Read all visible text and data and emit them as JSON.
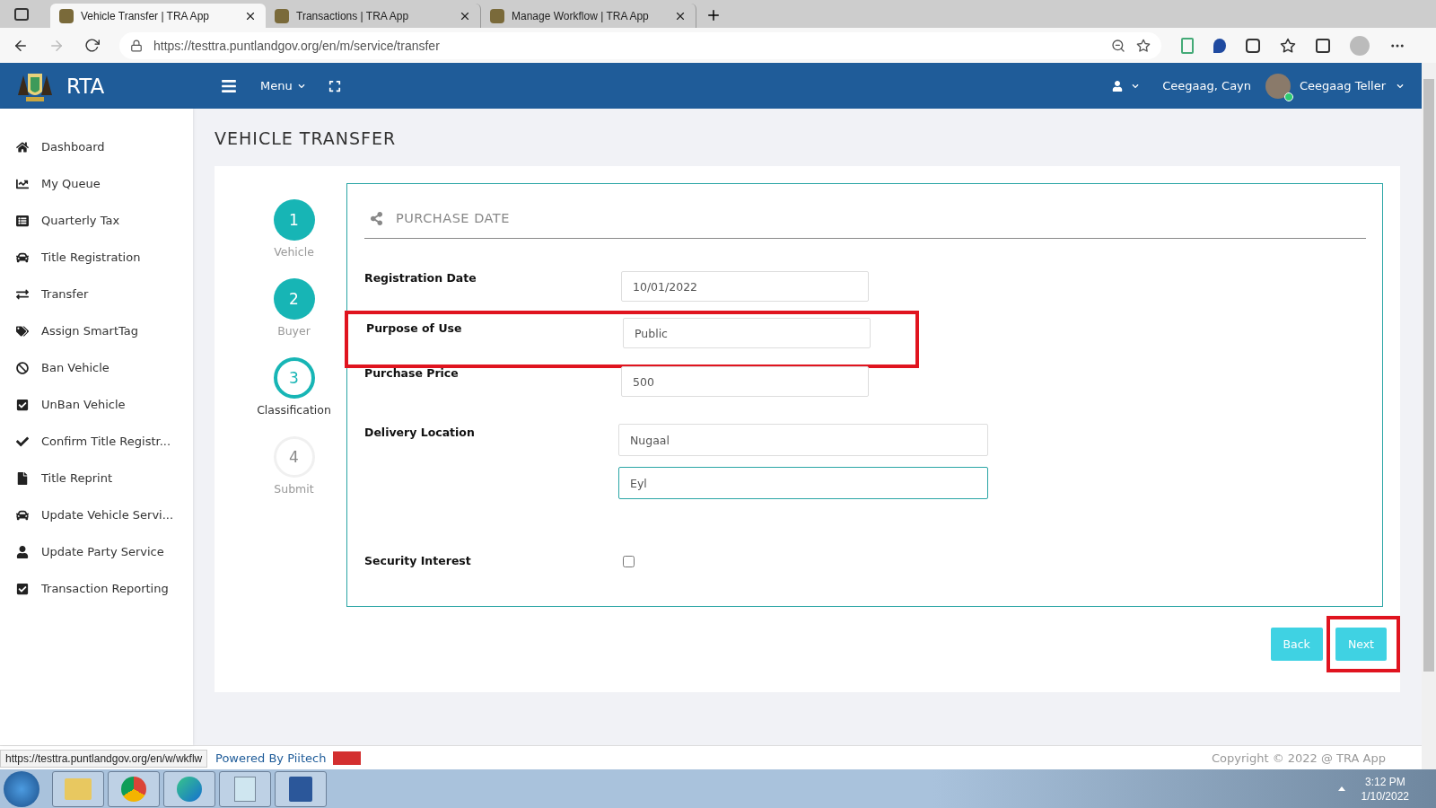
{
  "browser": {
    "tabs": [
      {
        "title": "Vehicle Transfer | TRA App",
        "selected": true
      },
      {
        "title": "Transactions | TRA App",
        "selected": false
      },
      {
        "title": "Manage Workflow | TRA App",
        "selected": false
      }
    ],
    "url": "https://testtra.puntlandgov.org/en/m/service/transfer"
  },
  "header": {
    "brand": "RTA",
    "menu": "Menu",
    "user_short": "Ceegaag, Cayn",
    "user_role": "Ceegaag Teller",
    "online": true
  },
  "sidebar": {
    "items": [
      {
        "label": "Dashboard"
      },
      {
        "label": "My Queue"
      },
      {
        "label": "Quarterly Tax"
      },
      {
        "label": "Title Registration"
      },
      {
        "label": "Transfer"
      },
      {
        "label": "Assign SmartTag"
      },
      {
        "label": "Ban Vehicle"
      },
      {
        "label": "UnBan Vehicle"
      },
      {
        "label": "Confirm Title Registr..."
      },
      {
        "label": "Title Reprint"
      },
      {
        "label": "Update Vehicle Servi..."
      },
      {
        "label": "Update Party Service"
      },
      {
        "label": "Transaction Reporting"
      }
    ]
  },
  "page_title": "VEHICLE TRANSFER",
  "steps": [
    {
      "number": "1",
      "label": "Vehicle",
      "done": true,
      "selected": false
    },
    {
      "number": "2",
      "label": "Buyer",
      "done": true,
      "selected": false
    },
    {
      "number": "3",
      "label": "Classification",
      "done": false,
      "selected": true
    },
    {
      "number": "4",
      "label": "Submit",
      "done": false,
      "selected": false
    }
  ],
  "form": {
    "section_title": "PURCHASE DATE",
    "fields": [
      {
        "label": "Registration Date",
        "kind": "text",
        "values": [
          "10/01/2022"
        ],
        "highlighted": false
      },
      {
        "label": "Purpose of Use",
        "kind": "text",
        "values": [
          "Public"
        ],
        "highlighted": true
      },
      {
        "label": "Purchase Price",
        "kind": "text",
        "values": [
          "500"
        ],
        "highlighted": false
      },
      {
        "label": "Delivery Location",
        "kind": "wide",
        "values": [
          "Nugaal",
          "Eyl"
        ],
        "highlighted": false
      },
      {
        "label": "Security Interest",
        "kind": "checkbox",
        "checked": false,
        "highlighted": false
      }
    ]
  },
  "buttons": [
    {
      "label": "Back",
      "highlighted": false
    },
    {
      "label": "Next",
      "highlighted": true
    }
  ],
  "footer": {
    "powered": "Powered By Piitech",
    "copyright": "Copyright © 2022 @ TRA App"
  },
  "status_link": "https://testtra.puntlandgov.org/en/w/wkflw",
  "taskbar": {
    "time": "3:12 PM",
    "date": "1/10/2022"
  }
}
